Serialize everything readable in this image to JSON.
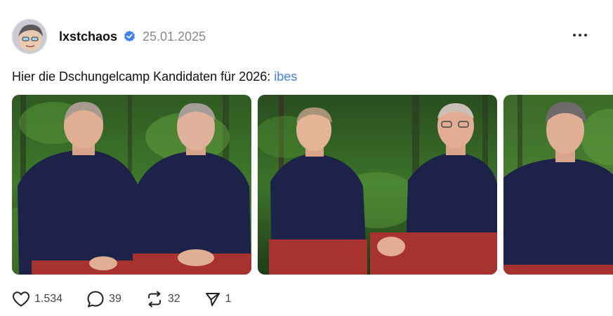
{
  "post": {
    "username": "lxstchaos",
    "timestamp": "25.01.2025",
    "text": "Hier die Dschungelcamp Kandidaten für 2026: ",
    "link_text": "ibes"
  },
  "icons": {
    "verified": "verified-badge-icon",
    "more": "more-options-icon",
    "like": "heart-icon",
    "reply": "comment-bubble-icon",
    "repost": "repost-icon",
    "share": "send-icon"
  },
  "actions": {
    "likes": "1.534",
    "replies": "39",
    "reposts": "32",
    "shares": "1"
  },
  "colors": {
    "link": "#3b82f6",
    "verified": "#3b82f6",
    "muted": "#8a8a8a"
  }
}
